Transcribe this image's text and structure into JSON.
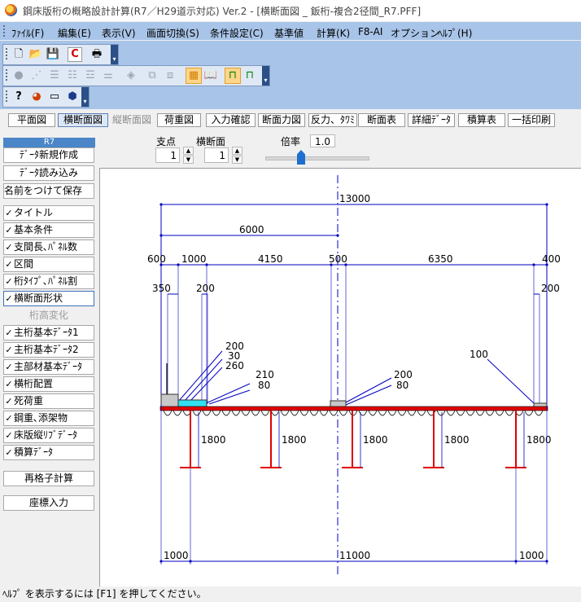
{
  "window": {
    "title": "鋼床版桁の概略設計計算(R7／H29道示対応) Ver.2 - [横断面図 _ 鈑桁-複合2径間_R7.PFF]"
  },
  "menu": [
    {
      "label": "ﾌｧｲﾙ(F)"
    },
    {
      "label": "編集(E)"
    },
    {
      "label": "表示(V)"
    },
    {
      "label": "画面切換(S)"
    },
    {
      "label": "条件設定(C)"
    },
    {
      "label": "基準値"
    },
    {
      "label": "計算(K)"
    },
    {
      "label": "F8-AI"
    },
    {
      "label": "オプション"
    },
    {
      "label": "ﾍﾙﾌﾟ(H)"
    }
  ],
  "toolbar_icons": {
    "row1": [
      "new-file-icon",
      "open-folder-icon",
      "save-icon",
      "c-logo-icon",
      "print-icon"
    ],
    "row2": [
      "ball-icon",
      "dots-icon",
      "align-1-icon",
      "align-2-icon",
      "align-3-icon",
      "align-4-icon",
      "eraser-icon",
      "copy-icon",
      "paste-icon",
      "grid-icon",
      "book-icon",
      "girder-icon",
      "girder-green-icon"
    ],
    "row3": [
      "help-icon",
      "colors-icon",
      "card-icon",
      "cube-icon"
    ]
  },
  "view_tabs": [
    {
      "label": "平面図",
      "state": "normal"
    },
    {
      "label": "横断面図",
      "state": "selected"
    },
    {
      "label": "縦断面図",
      "state": "disabled"
    },
    {
      "label": "荷重図",
      "state": "normal"
    },
    {
      "label": "入力確認",
      "state": "normal"
    },
    {
      "label": "断面力図",
      "state": "normal"
    },
    {
      "label": "反力、ﾀﾜﾐ",
      "state": "normal"
    },
    {
      "label": "断面表",
      "state": "normal"
    },
    {
      "label": "詳細ﾃﾞｰﾀ",
      "state": "normal"
    },
    {
      "label": "積算表",
      "state": "normal"
    },
    {
      "label": "一括印刷",
      "state": "normal"
    }
  ],
  "controls": {
    "support": {
      "label": "支点",
      "value": "1"
    },
    "cross_section": {
      "label": "横断面",
      "value": "1"
    },
    "zoom": {
      "label": "倍率",
      "value": "1.0",
      "slider_position": 0.32
    }
  },
  "sidebar": {
    "header": "R7",
    "buttons": [
      {
        "label": "ﾃﾞｰﾀ新規作成",
        "check": false,
        "state": "normal",
        "center": true
      },
      {
        "label": "ﾃﾞｰﾀ読み込み",
        "check": false,
        "state": "normal",
        "center": true
      },
      {
        "label": "名前をつけて保存",
        "check": false,
        "state": "normal",
        "center": false
      },
      {
        "label": "タイトル",
        "check": true,
        "state": "normal",
        "center": false
      },
      {
        "label": "基本条件",
        "check": true,
        "state": "normal",
        "center": false
      },
      {
        "label": "支間長､ﾊﾟﾈﾙ数",
        "check": true,
        "state": "normal",
        "center": false
      },
      {
        "label": "区間",
        "check": true,
        "state": "normal",
        "center": false
      },
      {
        "label": "桁ﾀｲﾌﾟ､ﾊﾟﾈﾙ割",
        "check": true,
        "state": "normal",
        "center": false
      },
      {
        "label": "横断面形状",
        "check": true,
        "state": "selected",
        "center": false
      },
      {
        "label": "桁高変化",
        "check": false,
        "state": "disabled",
        "center": true
      },
      {
        "label": "主桁基本ﾃﾞｰﾀ1",
        "check": true,
        "state": "normal",
        "center": false
      },
      {
        "label": "主桁基本ﾃﾞｰﾀ2",
        "check": true,
        "state": "normal",
        "center": false
      },
      {
        "label": "主部材基本ﾃﾞｰﾀ",
        "check": true,
        "state": "normal",
        "center": false
      },
      {
        "label": "横桁配置",
        "check": true,
        "state": "normal",
        "center": false
      },
      {
        "label": "死荷重",
        "check": true,
        "state": "normal",
        "center": false
      },
      {
        "label": "鋼重､添架物",
        "check": true,
        "state": "normal",
        "center": false
      },
      {
        "label": "床版縦ﾘﾌﾞﾃﾞｰﾀ",
        "check": true,
        "state": "normal",
        "center": false
      },
      {
        "label": "積算ﾃﾞｰﾀ",
        "check": true,
        "state": "normal",
        "center": false
      },
      {
        "label": "再格子計算",
        "check": false,
        "state": "normal",
        "center": true
      },
      {
        "label": "座標入力",
        "check": false,
        "state": "normal",
        "center": true
      }
    ]
  },
  "drawing": {
    "total_width": "13000",
    "centerline_offset": "6000",
    "segments": [
      "600",
      "1000",
      "4150",
      "500",
      "6350",
      "400"
    ],
    "left_dims": [
      "350",
      "200"
    ],
    "right_dim": "200",
    "left_annotations": [
      "200",
      "30",
      "260"
    ],
    "left_annotations2": [
      "210",
      "80"
    ],
    "center_annotations": [
      "200",
      "80"
    ],
    "right_annotation": "100",
    "girder_heights": [
      "1800",
      "1800",
      "1800",
      "1800",
      "1800"
    ],
    "bottom_dims": [
      "1000",
      "11000",
      "1000"
    ],
    "colors": {
      "deck": "#e00000",
      "dimension": "#0000c0",
      "girder": "#e00000",
      "curb_fill": "#33e0f0",
      "barrier": "#c8c8c8"
    }
  },
  "status": "ﾍﾙﾌﾟ を表示するには [F1] を押してください。"
}
